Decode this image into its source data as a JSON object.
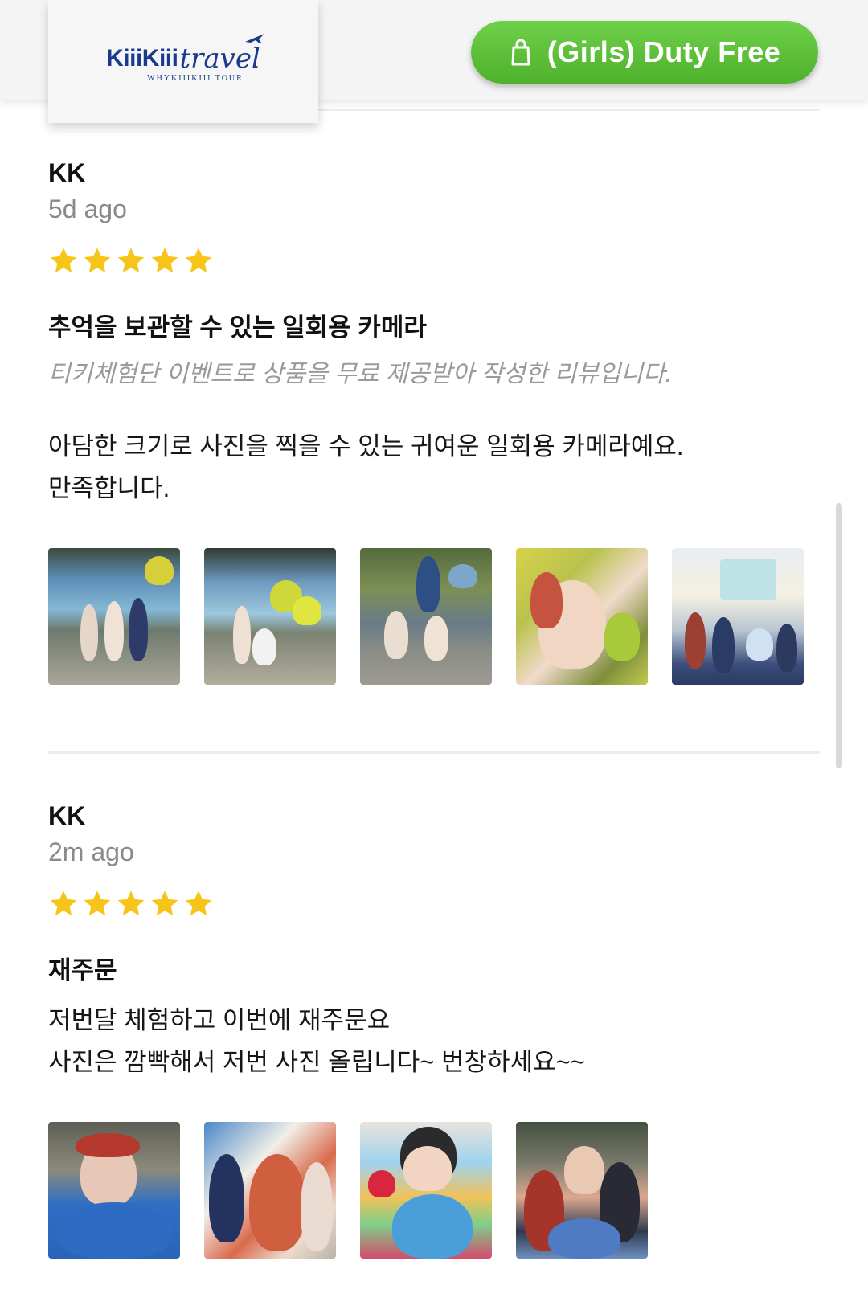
{
  "header": {
    "logo": {
      "main": "KiiiKiii",
      "script": "travel",
      "sub": "WHYKIIIKIII TOUR"
    },
    "duty_free_button": {
      "icon": "shopping-bag-icon",
      "label": "(Girls) Duty Free"
    }
  },
  "colors": {
    "accent_green": "#4fb22c",
    "star": "#f7c51a",
    "logo_blue": "#1b3a8c"
  },
  "reviews": [
    {
      "author": "KK",
      "time": "5d ago",
      "rating": 5,
      "title": "추억을 보관할 수 있는 일회용 카메라",
      "disclaimer": "티키체험단 이벤트로 상품을 무료 제공받아 작성한 리뷰입니다.",
      "body": [
        "아담한 크기로 사진을 찍을 수 있는 귀여운 일회용 카메라예요.",
        "만족합니다."
      ],
      "photo_count": 5
    },
    {
      "author": "KK",
      "time": "2m ago",
      "rating": 5,
      "title": "재주문",
      "body": [
        "저번달 체험하고 이번에 재주문요",
        "사진은 깜빡해서 저번 사진 올립니다~ 번창하세요~~"
      ],
      "photo_count": 4
    }
  ]
}
